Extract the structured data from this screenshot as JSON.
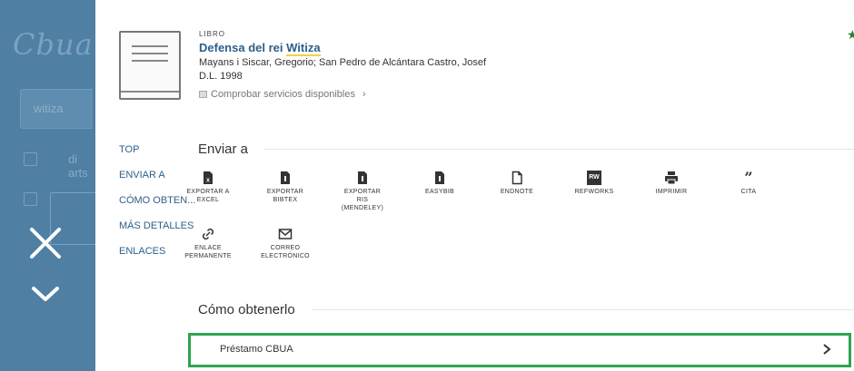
{
  "backdrop": {
    "logo": "Cbua",
    "search_value": "witiza",
    "list_text": "di arts"
  },
  "record": {
    "type": "LIBRO",
    "title_prefix": "Defensa del rei ",
    "title_highlight": "Witiza",
    "author": "Mayans i Siscar, Gregorio; San Pedro de Alcántara Castro, Josef",
    "date": "D.L. 1998",
    "availability": "Comprobar servicios disponibles",
    "availability_chevron": "›"
  },
  "nav": {
    "items": [
      "TOP",
      "ENVIAR A",
      "CÓMO OBTEN...",
      "MÁS DETALLES",
      "ENLACES"
    ]
  },
  "enviar": {
    "title": "Enviar a",
    "actions": [
      {
        "icon": "excel-file-icon",
        "label": "EXPORTAR A\nEXCEL"
      },
      {
        "icon": "bibtex-file-icon",
        "label": "EXPORTAR\nBIBTEX"
      },
      {
        "icon": "ris-file-icon",
        "label": "EXPORTAR\nRIS\n(MENDELEY)"
      },
      {
        "icon": "easybib-file-icon",
        "label": "EASYBIB"
      },
      {
        "icon": "endnote-file-icon",
        "label": "ENDNOTE"
      },
      {
        "icon": "refworks-icon",
        "label": "REFWORKS",
        "badge": "RW"
      },
      {
        "icon": "printer-icon",
        "label": "IMPRIMIR"
      },
      {
        "icon": "quote-icon",
        "label": "CITA",
        "glyph": "”"
      },
      {
        "icon": "link-icon",
        "label": "ENLACE\nPERMANENTE"
      },
      {
        "icon": "email-icon",
        "label": "CORREO\nELECTRÓNICO"
      }
    ]
  },
  "como": {
    "title": "Cómo obtenerlo",
    "row_label": "Préstamo CBUA"
  },
  "colors": {
    "accent": "#2d5f8a",
    "highlight_border": "#2ea44f",
    "backdrop": "#4f7fa3"
  }
}
